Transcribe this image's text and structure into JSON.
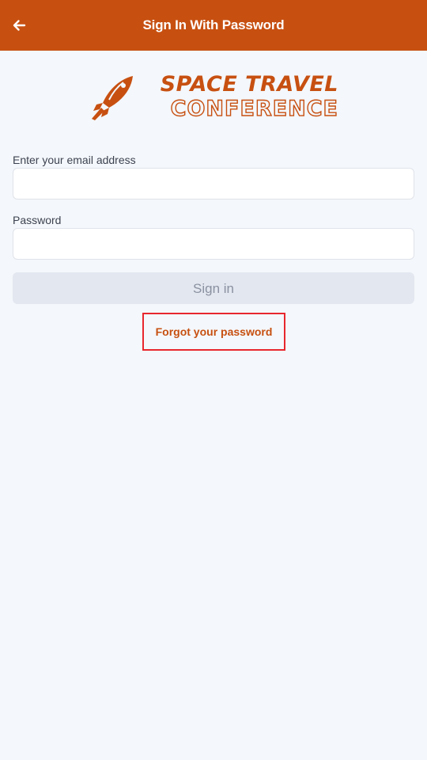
{
  "appbar": {
    "title": "Sign In With Password",
    "back_icon": "arrow-left-icon",
    "background": "#c75011"
  },
  "logo": {
    "line1": "SPACE TRAVEL",
    "line2": "CONFERENCE",
    "icon": "rocket-icon",
    "color": "#c75011"
  },
  "form": {
    "email_label": "Enter your email address",
    "email_value": "",
    "password_label": "Password",
    "password_value": "",
    "signin_label": "Sign in",
    "forgot_label": "Forgot your password"
  },
  "colors": {
    "accent": "#c75011",
    "highlight": "#e8272e",
    "disabled_button": "#e3e7f0"
  }
}
